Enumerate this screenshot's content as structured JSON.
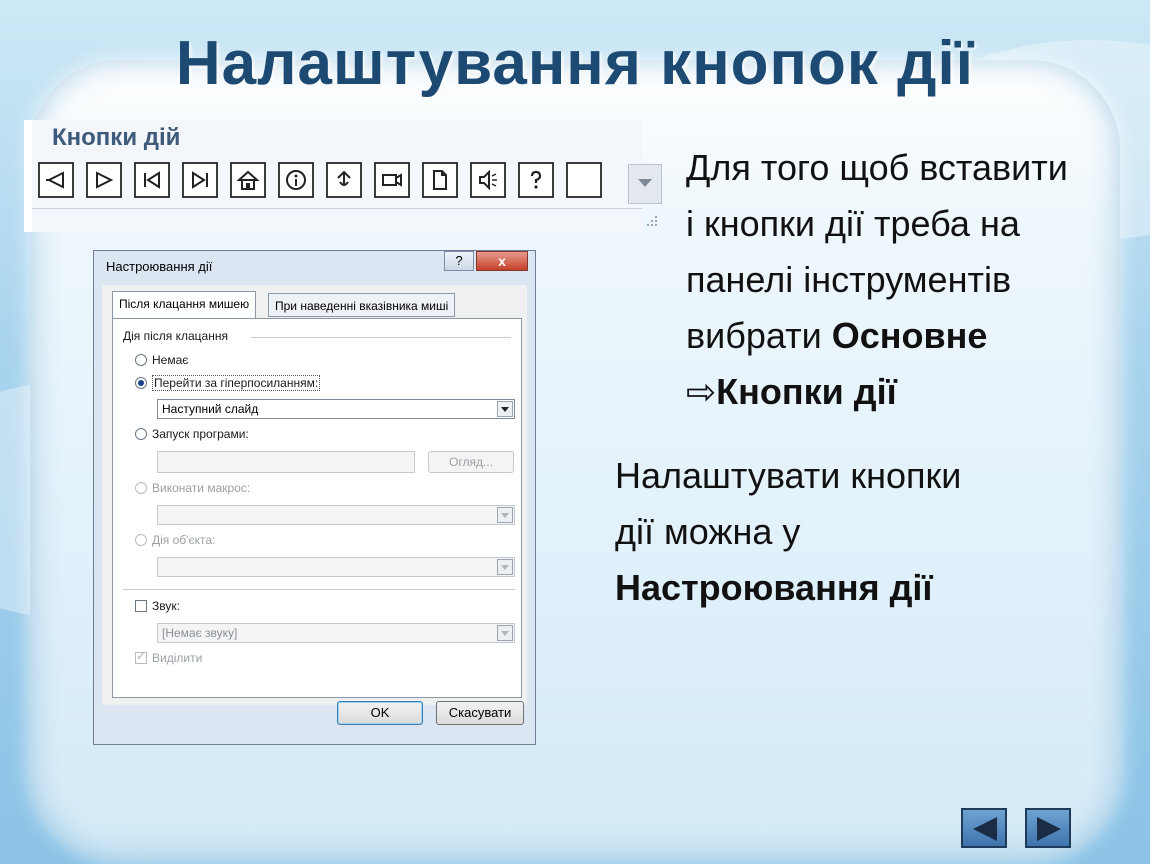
{
  "slide": {
    "title": "Налаштування кнопок дії",
    "colors": {
      "title": "#1d4a73",
      "frame": "#e2f1fa",
      "background": "#a9d4ee"
    }
  },
  "ribbon": {
    "group_title": "Кнопки дій",
    "buttons": [
      {
        "icon": "back-icon"
      },
      {
        "icon": "forward-icon"
      },
      {
        "icon": "beginning-icon"
      },
      {
        "icon": "end-icon"
      },
      {
        "icon": "home-icon"
      },
      {
        "icon": "information-icon"
      },
      {
        "icon": "return-icon"
      },
      {
        "icon": "movie-icon"
      },
      {
        "icon": "document-icon"
      },
      {
        "icon": "sound-icon"
      },
      {
        "icon": "help-icon"
      },
      {
        "icon": "custom-icon"
      }
    ]
  },
  "dialog": {
    "title": "Настроювання дії",
    "help_label": "?",
    "close_label": "x",
    "tabs": [
      {
        "label": "Після клацання мишею",
        "active": true
      },
      {
        "label": "При наведенні вказівника миші",
        "active": false
      }
    ],
    "group_label": "Дія після клацання",
    "options": {
      "none": "Немає",
      "hyperlink": "Перейти за гіперпосиланням:",
      "hyperlink_value": "Наступний слайд",
      "run_program": "Запуск програми:",
      "browse": "Огляд...",
      "run_macro": "Виконати макрос:",
      "object_action": "Дія об'єкта:",
      "sound": "Звук:",
      "sound_value": "[Немає звуку]",
      "highlight": "Виділити"
    },
    "ok_label": "OK",
    "cancel_label": "Скасувати"
  },
  "text": {
    "p1_line1": "Для того щоб вставити",
    "p1_line2": "і кнопки дії треба на",
    "p1_line3": "панелі інструментів",
    "p1_line4_a": "вибрати ",
    "p1_line4_b": "Основне",
    "p1_arrow": "⇨",
    "p1_line5": "Кнопки дії",
    "p2_line1": "Налаштувати кнопки",
    "p2_line2": "дії можна у",
    "p2_line3": "Настроювання дії"
  },
  "nav": {
    "prev": "previous-slide-icon",
    "next": "next-slide-icon"
  }
}
